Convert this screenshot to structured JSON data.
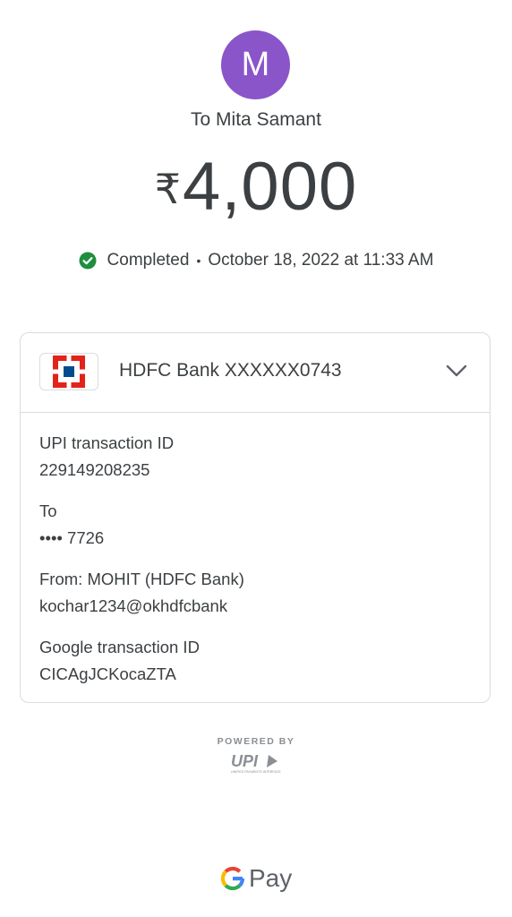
{
  "recipient": {
    "avatar_letter": "M",
    "to_label": "To Mita Samant"
  },
  "amount": {
    "currency_symbol": "₹",
    "value": "4,000"
  },
  "status": {
    "text": "Completed",
    "separator": "•",
    "datetime": "October 18, 2022 at 11:33 AM",
    "icon": "check-circle-icon",
    "color": "#1e8e3e"
  },
  "bank": {
    "name": "HDFC Bank XXXXXX0743",
    "logo": "hdfc-logo",
    "logo_colors": {
      "red": "#e2231a",
      "blue": "#004c8f"
    }
  },
  "details": [
    {
      "label": "UPI transaction ID",
      "value": "229149208235"
    },
    {
      "label": "To",
      "value": "•••• 7726"
    },
    {
      "label": "From: MOHIT (HDFC Bank)",
      "value": "kochar1234@okhdfcbank"
    },
    {
      "label": "Google transaction ID",
      "value": "CICAgJCKocaZTA"
    }
  ],
  "footer": {
    "powered_by": "POWERED BY",
    "upi_logo": "UPI",
    "upi_tagline": "UNIFIED PAYMENTS INTERFACE",
    "gpay_letter": "G",
    "gpay_text": "Pay"
  },
  "colors": {
    "avatar_bg": "#8a55c9",
    "text": "#3c4043",
    "border": "#dadce0"
  }
}
